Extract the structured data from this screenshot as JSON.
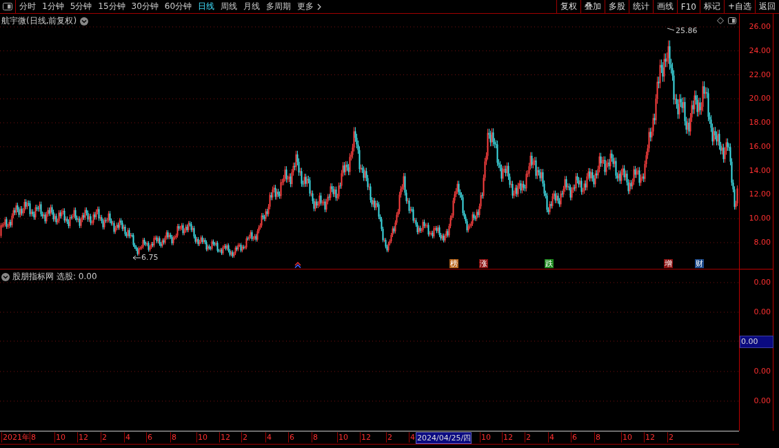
{
  "toolbar": {
    "tabs": [
      {
        "label": "分时",
        "selected": false
      },
      {
        "label": "1分钟",
        "selected": false
      },
      {
        "label": "5分钟",
        "selected": false
      },
      {
        "label": "15分钟",
        "selected": false
      },
      {
        "label": "30分钟",
        "selected": false
      },
      {
        "label": "60分钟",
        "selected": false
      },
      {
        "label": "日线",
        "selected": true
      },
      {
        "label": "周线",
        "selected": false
      },
      {
        "label": "月线",
        "selected": false
      },
      {
        "label": "多周期",
        "selected": false
      },
      {
        "label": "更多",
        "selected": false
      }
    ],
    "buttons": [
      "复权",
      "叠加",
      "多股",
      "统计",
      "画线",
      "F10",
      "标记",
      "+自选",
      "返回"
    ]
  },
  "chart": {
    "title": "航宇微(日线,前复权)",
    "high_label": "25.86",
    "low_label": "6.75",
    "y_labels": [
      "26.00",
      "24.00",
      "22.00",
      "20.00",
      "18.00",
      "16.00",
      "14.00",
      "12.00",
      "10.00",
      "8.00"
    ],
    "markers": [
      {
        "label": "榜",
        "color": "#b8661c"
      },
      {
        "label": "涨",
        "color": "#8c1010"
      },
      {
        "label": "跌",
        "color": "#1e8a1e"
      },
      {
        "label": "增",
        "color": "#8c1010"
      },
      {
        "label": "财",
        "color": "#1c4a8c"
      }
    ]
  },
  "indicator": {
    "title": "股朋指标网",
    "reading": "选股: 0.00",
    "y_labels": [
      {
        "text": "0.00",
        "kind": "tick"
      },
      {
        "text": "0.00",
        "kind": "tick"
      },
      {
        "text": "0.00",
        "kind": "current"
      },
      {
        "text": "0.00",
        "kind": "tick"
      },
      {
        "text": "0.00",
        "kind": "tick"
      }
    ]
  },
  "date_axis": {
    "labels": [
      {
        "text": "2021年",
        "selected": false
      },
      {
        "text": "8",
        "selected": false
      },
      {
        "text": "10",
        "selected": false
      },
      {
        "text": "12",
        "selected": false
      },
      {
        "text": "2",
        "selected": false
      },
      {
        "text": "4",
        "selected": false
      },
      {
        "text": "6",
        "selected": false
      },
      {
        "text": "8",
        "selected": false
      },
      {
        "text": "10",
        "selected": false
      },
      {
        "text": "12",
        "selected": false
      },
      {
        "text": "2",
        "selected": false
      },
      {
        "text": "4",
        "selected": false
      },
      {
        "text": "6",
        "selected": false
      },
      {
        "text": "8",
        "selected": false
      },
      {
        "text": "10",
        "selected": false
      },
      {
        "text": "12",
        "selected": false
      },
      {
        "text": "2",
        "selected": false
      },
      {
        "text": "4",
        "selected": false
      },
      {
        "text": "2024/04/25/四",
        "selected": true
      },
      {
        "text": "10",
        "selected": false
      },
      {
        "text": "12",
        "selected": false
      },
      {
        "text": "2",
        "selected": false
      },
      {
        "text": "4",
        "selected": false
      },
      {
        "text": "6",
        "selected": false
      },
      {
        "text": "8",
        "selected": false
      },
      {
        "text": "10",
        "selected": false
      },
      {
        "text": "12",
        "selected": false
      },
      {
        "text": "2",
        "selected": false
      }
    ]
  }
}
